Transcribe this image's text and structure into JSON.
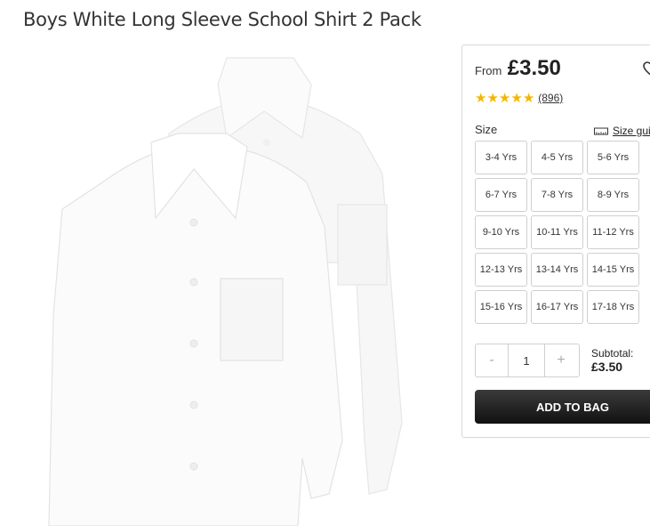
{
  "product": {
    "title": "Boys White Long Sleeve School Shirt 2 Pack",
    "from_label": "From",
    "price": "£3.50",
    "rating": 5,
    "review_count": "(896)"
  },
  "size": {
    "label": "Size",
    "guide_label": "Size gui",
    "options": [
      "3-4 Yrs",
      "4-5 Yrs",
      "5-6 Yrs",
      "6-7 Yrs",
      "7-8 Yrs",
      "8-9 Yrs",
      "9-10 Yrs",
      "10-11 Yrs",
      "11-12 Yrs",
      "12-13 Yrs",
      "13-14 Yrs",
      "14-15 Yrs",
      "15-16 Yrs",
      "16-17 Yrs",
      "17-18 Yrs"
    ]
  },
  "quantity": {
    "minus": "-",
    "value": "1",
    "plus": "+"
  },
  "subtotal": {
    "label": "Subtotal:",
    "value": "£3.50"
  },
  "actions": {
    "add_to_bag": "ADD TO BAG"
  },
  "icons": {
    "wishlist": "heart-icon",
    "size_guide": "ruler-icon",
    "stars": "star-icon"
  },
  "colors": {
    "star": "#f2b705",
    "button_bg": "#1a1a1a",
    "border": "#d8d8d8"
  }
}
